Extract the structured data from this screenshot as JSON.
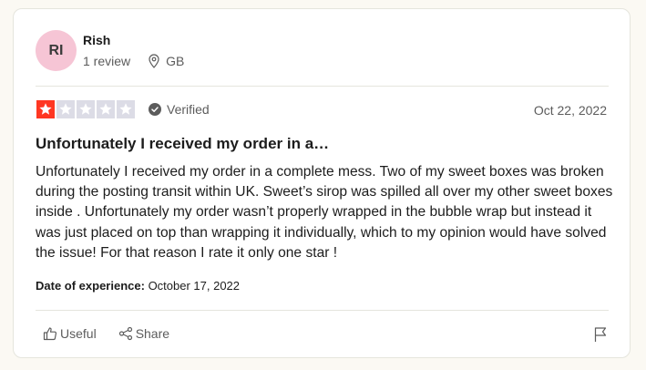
{
  "reviewer": {
    "initials": "RI",
    "name": "Rish",
    "review_count": "1 review",
    "country": "GB"
  },
  "rating": {
    "stars_filled": 1,
    "stars_total": 5,
    "filled_color": "#ff3722",
    "empty_color": "#dcdce6"
  },
  "verified_label": "Verified",
  "review_date": "Oct 22, 2022",
  "review": {
    "title": "Unfortunately I received my order in a…",
    "body": "Unfortunately I received my order in a complete mess. Two of my sweet boxes was broken during the posting transit within UK. Sweet’s sirop was spilled all over my other sweet boxes inside . Unfortunately my order wasn’t properly wrapped in the bubble wrap but instead it was just placed on top than wrapping it individually, which to my opinion would have solved the issue! For that reason I rate it only one star !"
  },
  "experience": {
    "label": "Date of experience:",
    "date": "October 17, 2022"
  },
  "actions": {
    "useful_label": "Useful",
    "share_label": "Share"
  },
  "icons": {
    "location": "location-pin-icon",
    "verified": "verified-check-icon",
    "useful": "thumbs-up-icon",
    "share": "share-icon",
    "flag": "flag-icon"
  },
  "colors": {
    "avatar_bg": "#f6c5d5",
    "page_bg": "#fbf9f3"
  }
}
